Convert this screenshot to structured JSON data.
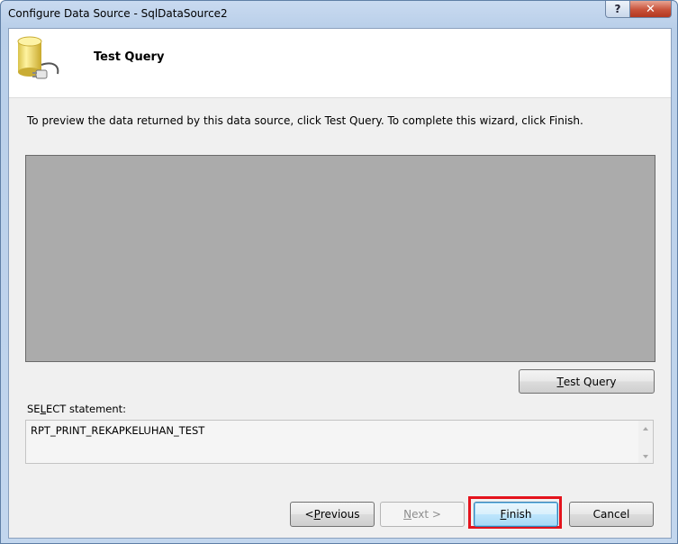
{
  "window": {
    "title": "Configure Data Source - SqlDataSource2",
    "help_label": "?",
    "close_label": "✕"
  },
  "header": {
    "title": "Test Query",
    "icon": "database-plug-icon"
  },
  "instructions": "To preview the data returned by this data source, click Test Query. To complete this wizard, click Finish.",
  "test_query_button": {
    "pre": "",
    "key": "T",
    "post": "est Query"
  },
  "select_statement": {
    "label_pre": "SE",
    "label_key": "L",
    "label_post": "ECT statement:",
    "value": "RPT_PRINT_REKAPKELUHAN_TEST"
  },
  "footer": {
    "previous": {
      "pre": "< ",
      "key": "P",
      "post": "revious"
    },
    "next": {
      "pre": "",
      "key": "N",
      "post": "ext >"
    },
    "finish": {
      "pre": "",
      "key": "F",
      "post": "inish"
    },
    "cancel": "Cancel"
  },
  "colors": {
    "highlight": "#e4131c",
    "preview_bg": "#ababab"
  }
}
